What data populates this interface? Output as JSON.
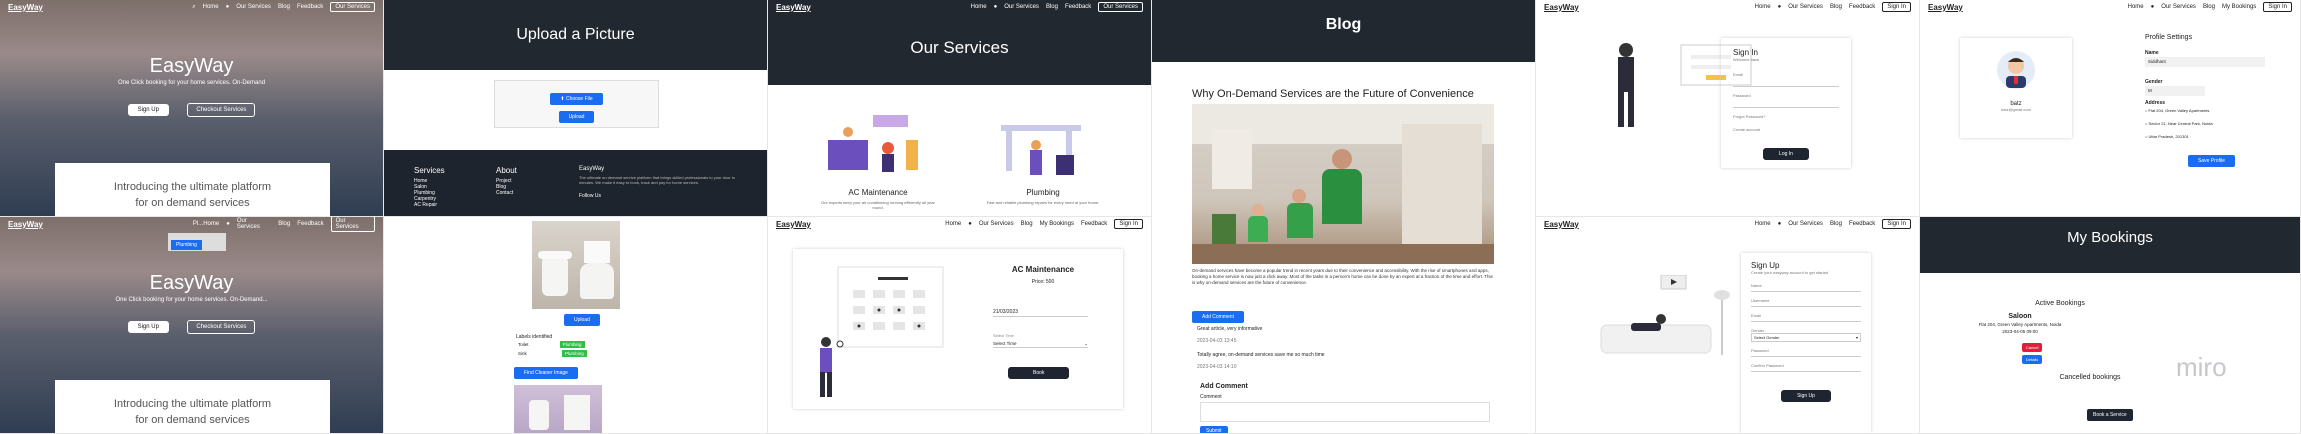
{
  "nav": {
    "brand": "EasyWay",
    "home": "Home",
    "our_services": "Our Services",
    "blog": "Blog",
    "feedback": "Feedback",
    "my_bookings": "My Bookings",
    "sign_in": "Sign In",
    "our_services_btn": "Our Services"
  },
  "hero1": {
    "title": "EasyWay",
    "subtitle": "One Click booking for your home services. On-Demand",
    "sign_up": "Sign Up",
    "checkout": "Checkout Services",
    "intro_line1": "Introducing the ultimate platform",
    "intro_line2": "for on demand services"
  },
  "upload": {
    "title": "Upload a Picture",
    "choose_file": "Choose File",
    "upload_btn": "Upload"
  },
  "footer": {
    "services": "Services",
    "services_items": [
      "Home",
      "Salon",
      "Plumbing",
      "Carpentry",
      "AC Repair"
    ],
    "about": "About",
    "about_items": [
      "Project",
      "Blog",
      "Contact"
    ],
    "brand": "EasyWay",
    "desc": "The ultimate on demand service platform that brings skilled professionals to your door in minutes. We make it easy to book, track and pay for home services.",
    "follow": "Follow Us"
  },
  "services": {
    "title": "Our Services",
    "ac_title": "AC Maintenance",
    "ac_desc": "Our experts keep your air conditioning running efficiently all year round.",
    "plumbing_title": "Plumbing",
    "plumbing_desc": "Fast and reliable plumbing repairs for every need at your home."
  },
  "blog": {
    "title": "Blog",
    "post_title": "Why On-Demand Services are the Future of Convenience",
    "body": "On-demand services have become a popular trend in recent years due to their convenience and accessibility. With the rise of smartphones and apps, booking a home service is now just a click away. Most of the tasks in a person's home can be done by an expert at a fraction of the time and effort. This is why on-demand services are the future of convenience.",
    "add_comment_btn": "Add Comment",
    "comment1": "Great article, very informative",
    "comment1_date": "2023-04-03 13:45",
    "comment2": "Totally agree, on-demand services save me so much time",
    "comment2_date": "2023-04-03 14:10",
    "add_comment_heading": "Add Comment",
    "comment_label": "Comment",
    "submit": "Submit"
  },
  "signin": {
    "title": "Sign In",
    "welcome": "Welcome back",
    "email_label": "Email",
    "password_label": "Password",
    "forgot": "Forgot Password?",
    "signup_link": "Create account",
    "login_btn": "Log In"
  },
  "profile": {
    "settings": "Profile Settings",
    "name_label": "Name",
    "name_value": "Siddhant",
    "gender_label": "Gender",
    "gender_value": "M",
    "username": "batz",
    "email": "batz@gmail.com",
    "address_label": "Address",
    "address1": "Flat 204, Green Valley Apartments",
    "address2": "Sector 21, Near Central Park, Noida",
    "address3": "Uttar Pradesh, 201301",
    "save_btn": "Save Profile"
  },
  "hero2": {
    "search_placeholder": "Pl...",
    "suggestion": "Plumbing",
    "title": "EasyWay",
    "subtitle": "One Click booking for your home services. On-Demand...",
    "sign_up": "Sign Up",
    "checkout": "Checkout Services",
    "intro_line1": "Introducing the ultimate platform",
    "intro_line2": "for on demand services"
  },
  "upload_result": {
    "upload_btn": "Upload",
    "caption": "Labels identified",
    "label1": "Toilet",
    "label2": "Sink",
    "tag1": "Plumbing",
    "tag2": "Plumbing",
    "find_btn": "Find Cleaner Image"
  },
  "booking": {
    "title": "AC Maintenance",
    "price": "Price: 500",
    "date_value": "21/03/2023",
    "time_label": "Select Time",
    "time_value": "Select Time",
    "book_btn": "Book"
  },
  "signup": {
    "title": "Sign Up",
    "subtitle": "Create your easyway account to get started",
    "name_label": "Name",
    "username_label": "Username",
    "email_label": "Email",
    "gender_label": "Gender",
    "gender_value": "Select Gender",
    "password_label": "Password",
    "confirm_label": "Confirm Password",
    "btn": "Sign Up"
  },
  "mybookings": {
    "title": "My Bookings",
    "active": "Active Bookings",
    "service": "Saloon",
    "address": "Flat 204, Green Valley Apartments, Noida",
    "datetime": "2023-04-05 09:00",
    "cancel_btn": "Cancel",
    "details_btn": "Details",
    "cancelled": "Cancelled bookings",
    "book_btn": "Book a Service",
    "watermark": "miro"
  },
  "colors": {
    "accent": "#1a6df0",
    "dark": "#222830",
    "green": "#2fbf4a"
  }
}
